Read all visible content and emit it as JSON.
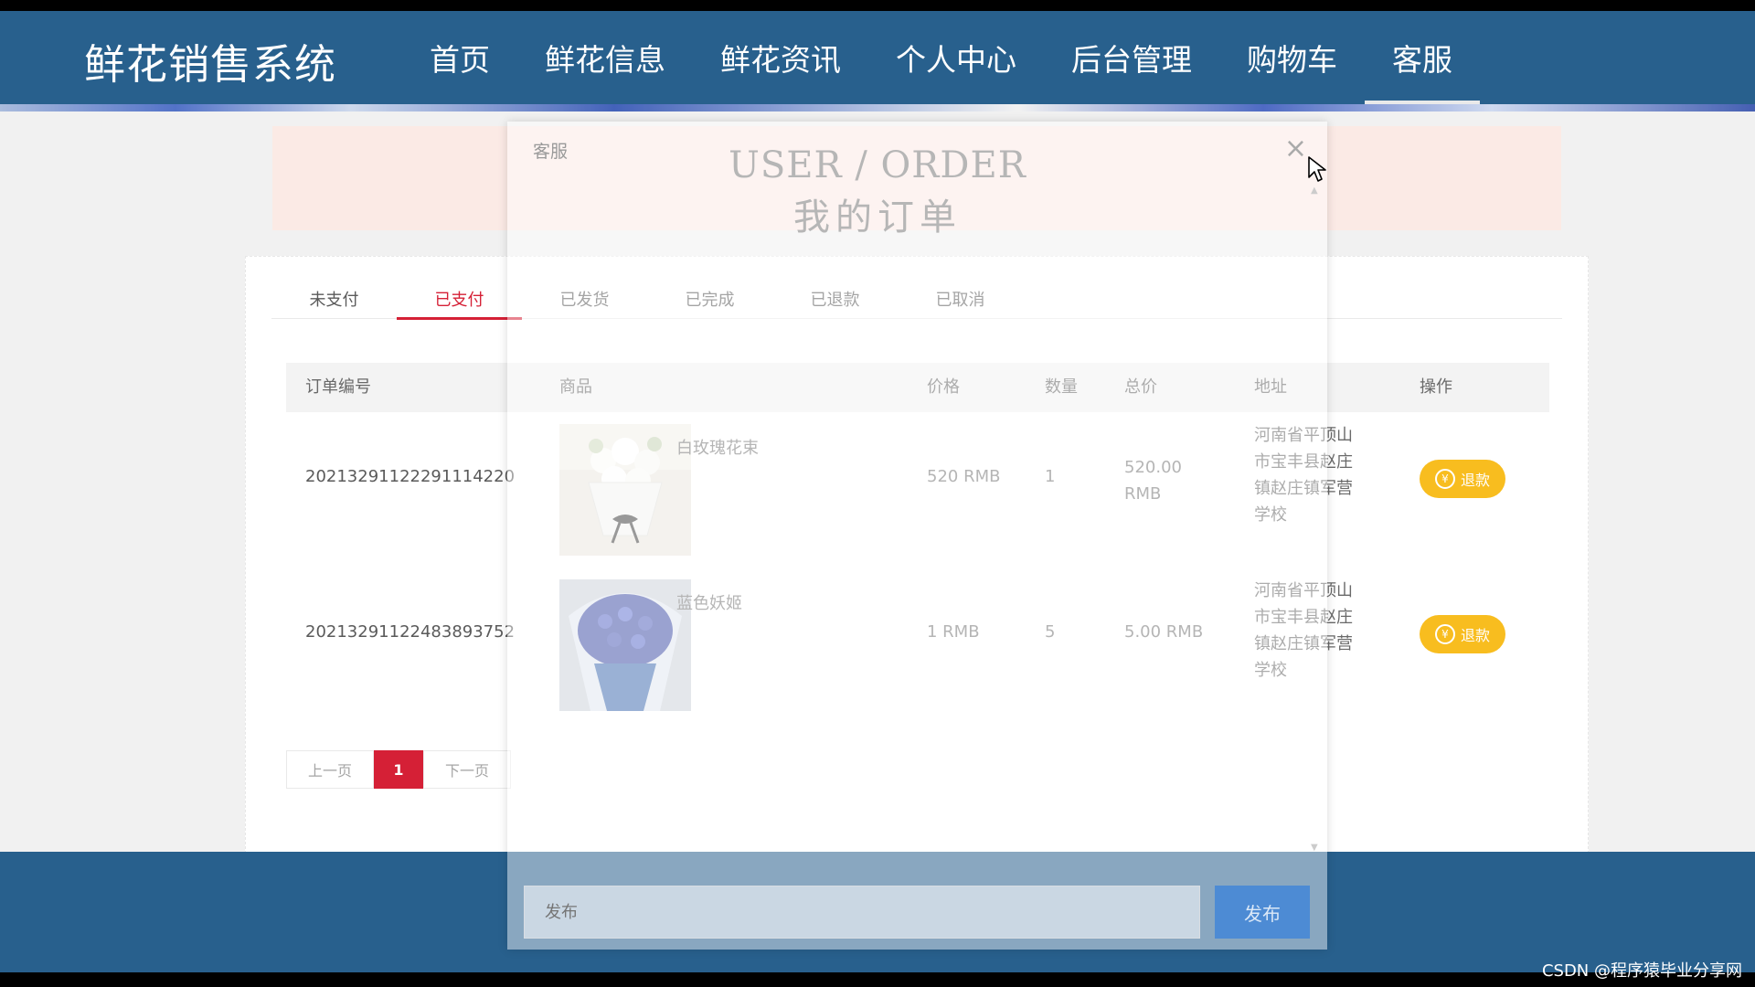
{
  "header": {
    "brand": "鲜花销售系统",
    "nav": [
      "首页",
      "鲜花信息",
      "鲜花资讯",
      "个人中心",
      "后台管理",
      "购物车",
      "客服"
    ],
    "active_index": 6
  },
  "orders": {
    "tabs": [
      "未支付",
      "已支付",
      "已发货",
      "已完成",
      "已退款",
      "已取消"
    ],
    "active_tab": 1,
    "columns": {
      "order_no": "订单编号",
      "product": "商品",
      "price": "价格",
      "qty": "数量",
      "total": "总价",
      "address": "地址",
      "action": "操作"
    },
    "rows": [
      {
        "order_no": "20213291122291114220",
        "product": "白玫瑰花束",
        "price": "520 RMB",
        "qty": "1",
        "total": "520.00 RMB",
        "address": "河南省平顶山市宝丰县赵庄镇赵庄镇军营学校",
        "action": "退款"
      },
      {
        "order_no": "20213291122483893752",
        "product": "蓝色妖姬",
        "price": "1 RMB",
        "qty": "5",
        "total": "5.00 RMB",
        "address": "河南省平顶山市宝丰县赵庄镇赵庄镇军营学校",
        "action": "退款"
      }
    ],
    "pager": {
      "prev": "上一页",
      "current": "1",
      "next": "下一页"
    }
  },
  "modal": {
    "title": "客服",
    "close_glyph": "×",
    "heading_en": "USER / ORDER",
    "heading_cn": "我的订单",
    "input_placeholder": "发布",
    "send_label": "发布"
  },
  "watermark": "CSDN @程序猿毕业分享网",
  "colors": {
    "nav_bg": "#0b4a7e",
    "accent_red": "#d0021b",
    "refund_yellow": "#f8b400",
    "send_blue": "#4d8bd4"
  }
}
